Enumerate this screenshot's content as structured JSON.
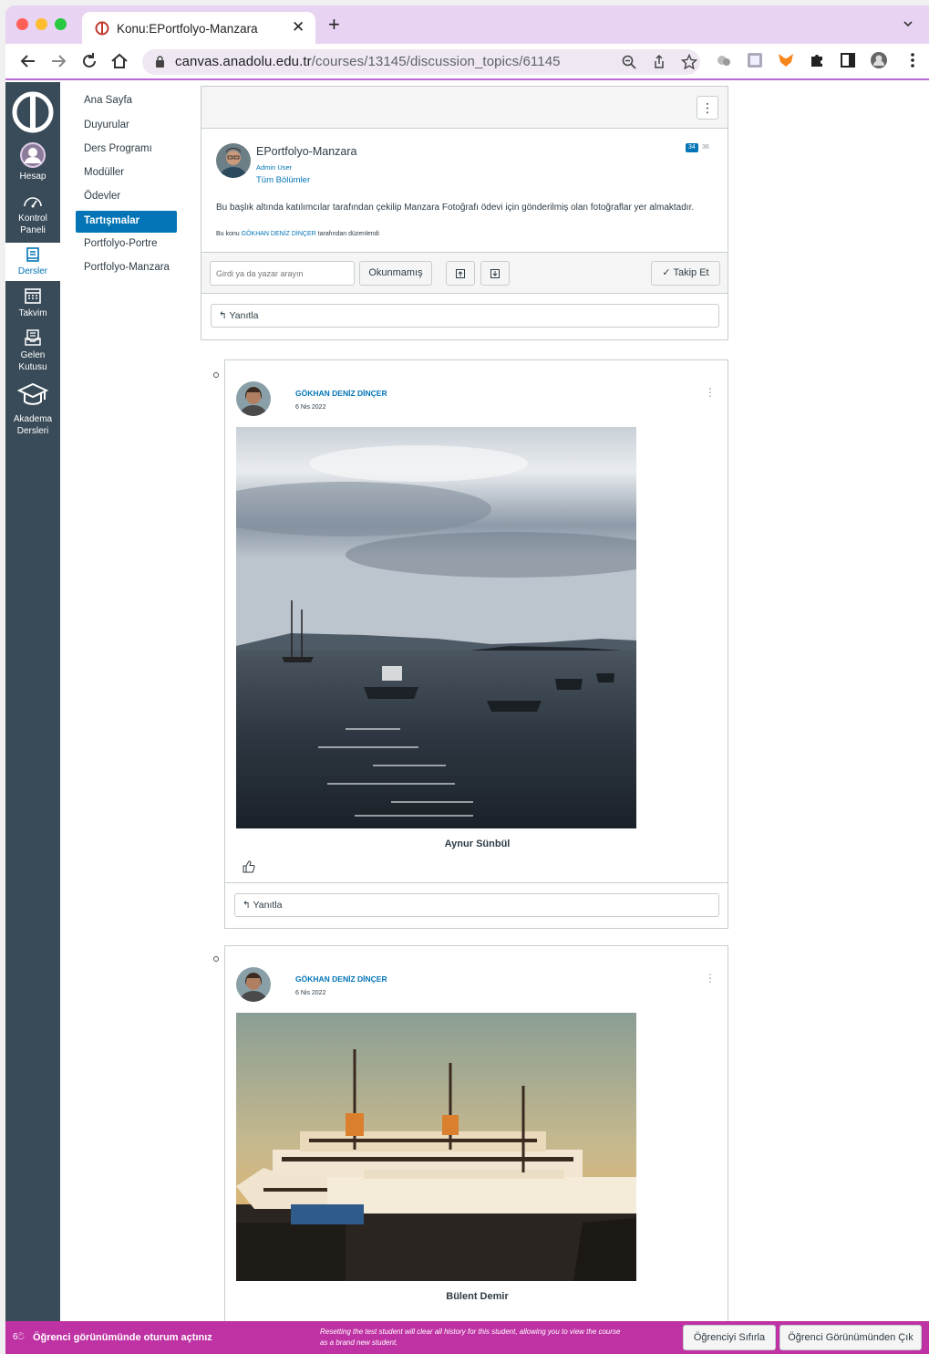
{
  "browser": {
    "tab_title": "Konu:EPortfolyo-Manzara",
    "url_host": "canvas.anadolu.edu.tr",
    "url_path": "/courses/13145/discussion_topics/61145"
  },
  "global_nav": {
    "items": [
      {
        "label": "Hesap",
        "icon": "account-icon"
      },
      {
        "label": "Kontrol Paneli",
        "icon": "dashboard-icon"
      },
      {
        "label": "Dersler",
        "icon": "courses-icon"
      },
      {
        "label": "Takvim",
        "icon": "calendar-icon"
      },
      {
        "label": "Gelen Kutusu",
        "icon": "inbox-icon"
      },
      {
        "label": "Akadema Dersleri",
        "icon": "graduation-cap-icon"
      }
    ]
  },
  "course_nav": {
    "items": [
      {
        "label": "Ana Sayfa"
      },
      {
        "label": "Duyurular"
      },
      {
        "label": "Ders Programı"
      },
      {
        "label": "Modüller"
      },
      {
        "label": "Ödevler"
      },
      {
        "label": "Tartışmalar"
      },
      {
        "label": "Portfolyo-Portre"
      },
      {
        "label": "Portfolyo-Manzara"
      }
    ],
    "active": "Tartışmalar"
  },
  "topic": {
    "author": "EPortfolyo-Manzara",
    "role": "Admin User",
    "sections": "Tüm Bölümler",
    "unread_count": "34",
    "total_count": "36",
    "body": "Bu başlık altında katılımcılar tarafından çekilip Manzara Fotoğrafı ödevi için gönderilmiş olan fotoğraflar yer almaktadır.",
    "edited_prefix": "Bu konu",
    "edited_by": "GÖKHAN DENİZ DİNÇER",
    "edited_suffix": "tarafından düzenlendi",
    "search_placeholder": "Girdi ya da yazar arayın",
    "unread_button": "Okunmamış",
    "follow_button": "Takip Et",
    "reply_label": "Yanıtla"
  },
  "entries": [
    {
      "author": "GÖKHAN DENİZ DİNÇER",
      "date": "6 Nis 2022",
      "caption": "Aynur Sünbül",
      "reply_label": "Yanıtla"
    },
    {
      "author": "GÖKHAN DENİZ DİNÇER",
      "date": "6 Nis 2022",
      "caption": "Bülent Demir"
    }
  ],
  "student_view": {
    "message": "Öğrenci görünümünde oturum açtınız",
    "note": "Resetting the test student will clear all history for this student, allowing you to view the course as a brand new student.",
    "reset_button": "Öğrenciyi Sıfırla",
    "exit_button": "Öğrenci Görünümünden Çık"
  },
  "colors": {
    "canvas_blue": "#0374b5",
    "nav_dark": "#394b58",
    "student_view_bar": "#bf32a4",
    "tabbar": "#e8d3f2"
  }
}
